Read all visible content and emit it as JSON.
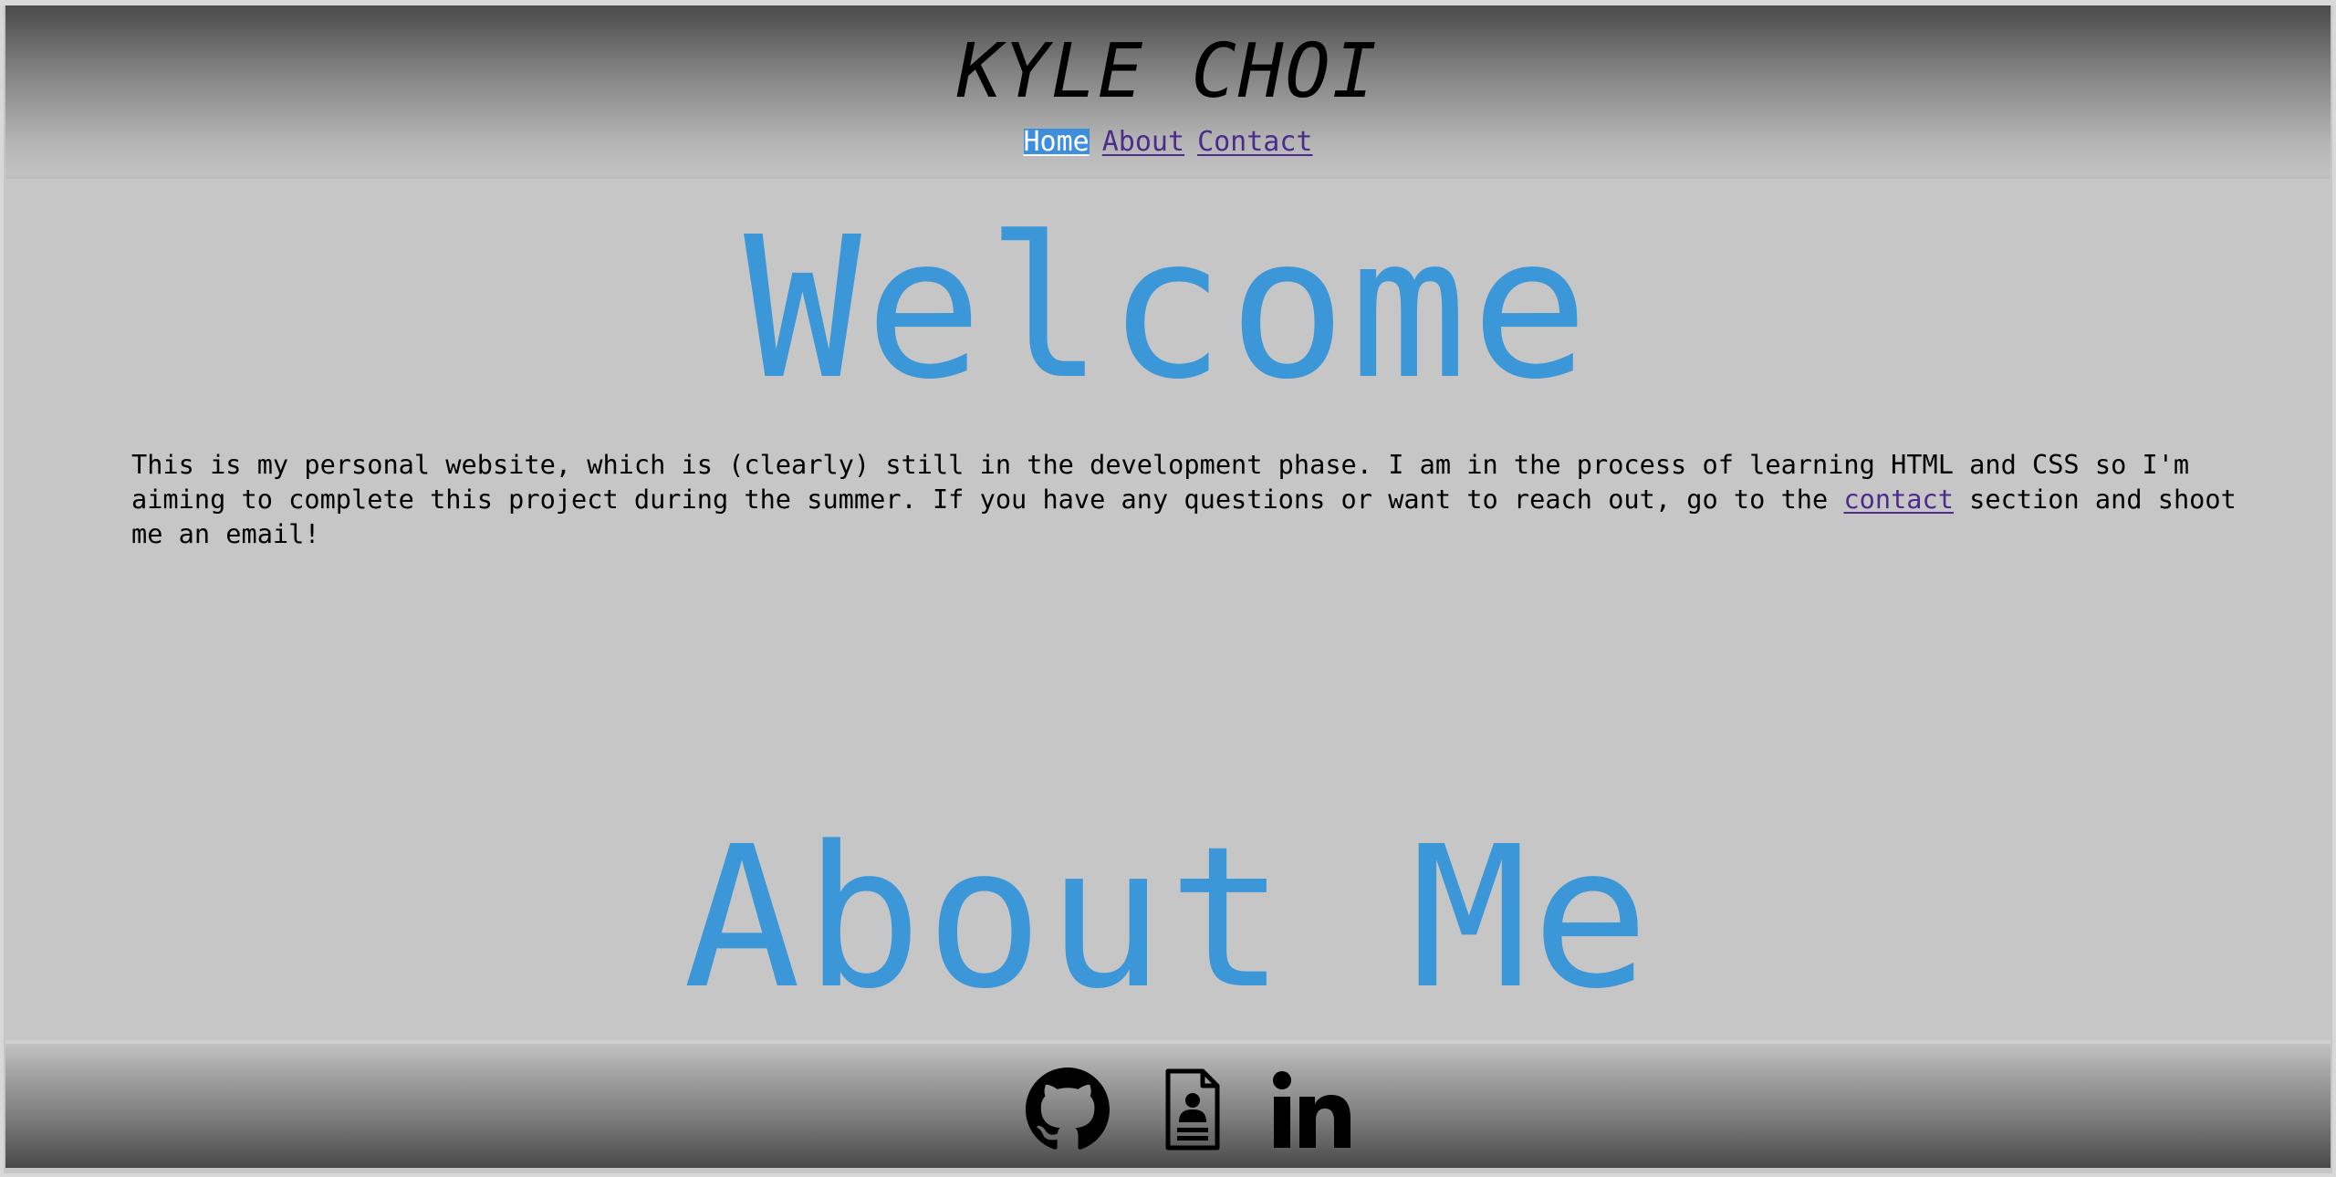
{
  "header": {
    "title": "KYLE CHOI",
    "nav": {
      "home": "Home",
      "about": "About",
      "contact": "Contact"
    }
  },
  "main": {
    "welcome_heading": "Welcome",
    "intro_before_link": "This is my personal website, which is (clearly) still in the development phase. I am in the process of learning HTML and CSS so I'm aiming to complete this project during the summer. If you have any questions or want to reach out, go to the ",
    "intro_link": "contact",
    "intro_after_link": " section and shoot me an email!",
    "about_heading": "About Me"
  },
  "footer": {
    "icons": [
      "github-icon",
      "resume-icon",
      "linkedin-icon"
    ]
  },
  "colors": {
    "accent": "#3c97d9",
    "link": "#4b2b8c",
    "background": "#c6c6c6",
    "nav_active_bg": "#3d8edd"
  }
}
